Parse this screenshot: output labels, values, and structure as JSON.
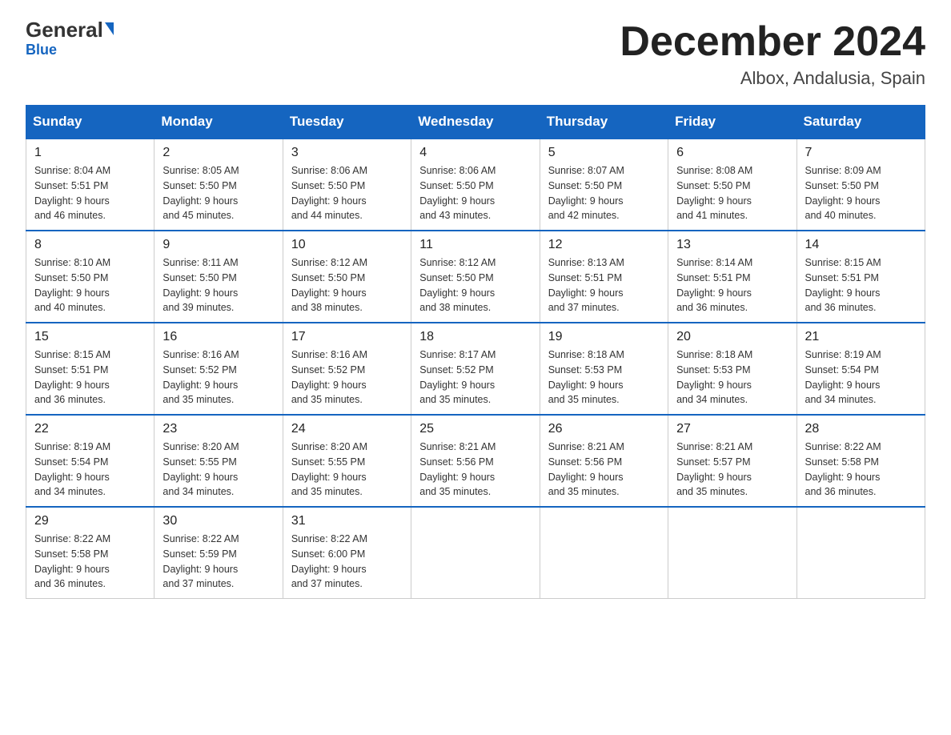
{
  "logo": {
    "general": "General",
    "blue": "Blue",
    "tagline": "Blue"
  },
  "header": {
    "month": "December 2024",
    "location": "Albox, Andalusia, Spain"
  },
  "weekdays": [
    "Sunday",
    "Monday",
    "Tuesday",
    "Wednesday",
    "Thursday",
    "Friday",
    "Saturday"
  ],
  "weeks": [
    [
      {
        "day": "1",
        "sunrise": "8:04 AM",
        "sunset": "5:51 PM",
        "daylight": "9 hours and 46 minutes."
      },
      {
        "day": "2",
        "sunrise": "8:05 AM",
        "sunset": "5:50 PM",
        "daylight": "9 hours and 45 minutes."
      },
      {
        "day": "3",
        "sunrise": "8:06 AM",
        "sunset": "5:50 PM",
        "daylight": "9 hours and 44 minutes."
      },
      {
        "day": "4",
        "sunrise": "8:06 AM",
        "sunset": "5:50 PM",
        "daylight": "9 hours and 43 minutes."
      },
      {
        "day": "5",
        "sunrise": "8:07 AM",
        "sunset": "5:50 PM",
        "daylight": "9 hours and 42 minutes."
      },
      {
        "day": "6",
        "sunrise": "8:08 AM",
        "sunset": "5:50 PM",
        "daylight": "9 hours and 41 minutes."
      },
      {
        "day": "7",
        "sunrise": "8:09 AM",
        "sunset": "5:50 PM",
        "daylight": "9 hours and 40 minutes."
      }
    ],
    [
      {
        "day": "8",
        "sunrise": "8:10 AM",
        "sunset": "5:50 PM",
        "daylight": "9 hours and 40 minutes."
      },
      {
        "day": "9",
        "sunrise": "8:11 AM",
        "sunset": "5:50 PM",
        "daylight": "9 hours and 39 minutes."
      },
      {
        "day": "10",
        "sunrise": "8:12 AM",
        "sunset": "5:50 PM",
        "daylight": "9 hours and 38 minutes."
      },
      {
        "day": "11",
        "sunrise": "8:12 AM",
        "sunset": "5:50 PM",
        "daylight": "9 hours and 38 minutes."
      },
      {
        "day": "12",
        "sunrise": "8:13 AM",
        "sunset": "5:51 PM",
        "daylight": "9 hours and 37 minutes."
      },
      {
        "day": "13",
        "sunrise": "8:14 AM",
        "sunset": "5:51 PM",
        "daylight": "9 hours and 36 minutes."
      },
      {
        "day": "14",
        "sunrise": "8:15 AM",
        "sunset": "5:51 PM",
        "daylight": "9 hours and 36 minutes."
      }
    ],
    [
      {
        "day": "15",
        "sunrise": "8:15 AM",
        "sunset": "5:51 PM",
        "daylight": "9 hours and 36 minutes."
      },
      {
        "day": "16",
        "sunrise": "8:16 AM",
        "sunset": "5:52 PM",
        "daylight": "9 hours and 35 minutes."
      },
      {
        "day": "17",
        "sunrise": "8:16 AM",
        "sunset": "5:52 PM",
        "daylight": "9 hours and 35 minutes."
      },
      {
        "day": "18",
        "sunrise": "8:17 AM",
        "sunset": "5:52 PM",
        "daylight": "9 hours and 35 minutes."
      },
      {
        "day": "19",
        "sunrise": "8:18 AM",
        "sunset": "5:53 PM",
        "daylight": "9 hours and 35 minutes."
      },
      {
        "day": "20",
        "sunrise": "8:18 AM",
        "sunset": "5:53 PM",
        "daylight": "9 hours and 34 minutes."
      },
      {
        "day": "21",
        "sunrise": "8:19 AM",
        "sunset": "5:54 PM",
        "daylight": "9 hours and 34 minutes."
      }
    ],
    [
      {
        "day": "22",
        "sunrise": "8:19 AM",
        "sunset": "5:54 PM",
        "daylight": "9 hours and 34 minutes."
      },
      {
        "day": "23",
        "sunrise": "8:20 AM",
        "sunset": "5:55 PM",
        "daylight": "9 hours and 34 minutes."
      },
      {
        "day": "24",
        "sunrise": "8:20 AM",
        "sunset": "5:55 PM",
        "daylight": "9 hours and 35 minutes."
      },
      {
        "day": "25",
        "sunrise": "8:21 AM",
        "sunset": "5:56 PM",
        "daylight": "9 hours and 35 minutes."
      },
      {
        "day": "26",
        "sunrise": "8:21 AM",
        "sunset": "5:56 PM",
        "daylight": "9 hours and 35 minutes."
      },
      {
        "day": "27",
        "sunrise": "8:21 AM",
        "sunset": "5:57 PM",
        "daylight": "9 hours and 35 minutes."
      },
      {
        "day": "28",
        "sunrise": "8:22 AM",
        "sunset": "5:58 PM",
        "daylight": "9 hours and 36 minutes."
      }
    ],
    [
      {
        "day": "29",
        "sunrise": "8:22 AM",
        "sunset": "5:58 PM",
        "daylight": "9 hours and 36 minutes."
      },
      {
        "day": "30",
        "sunrise": "8:22 AM",
        "sunset": "5:59 PM",
        "daylight": "9 hours and 37 minutes."
      },
      {
        "day": "31",
        "sunrise": "8:22 AM",
        "sunset": "6:00 PM",
        "daylight": "9 hours and 37 minutes."
      },
      null,
      null,
      null,
      null
    ]
  ],
  "labels": {
    "sunrise": "Sunrise:",
    "sunset": "Sunset:",
    "daylight": "Daylight:"
  }
}
